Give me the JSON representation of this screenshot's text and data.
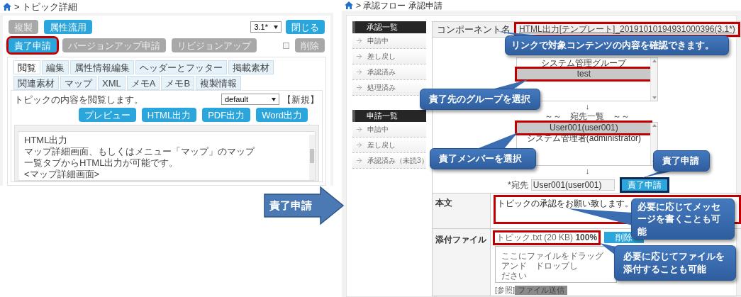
{
  "left_screen": {
    "breadcrumb": "> トピック詳細",
    "top_buttons": [
      {
        "label": "複製",
        "disabled": true
      },
      {
        "label": "属性流用",
        "disabled": false
      }
    ],
    "version_select": "3.1*",
    "close_button": "閉じる",
    "action_buttons": [
      {
        "label": "責了申請",
        "disabled": false,
        "highlighted": true
      },
      {
        "label": "バージョンアップ申請",
        "disabled": true,
        "highlighted": false
      },
      {
        "label": "リビジョンアップ",
        "disabled": true,
        "highlighted": false
      }
    ],
    "delete_checked": false,
    "delete_button": {
      "label": "削除",
      "disabled": true
    },
    "tabs": [
      {
        "label": "閲覧",
        "selected": true
      },
      {
        "label": "編集",
        "selected": false
      },
      {
        "label": "属性情報編集",
        "selected": false
      },
      {
        "label": "ヘッダーとフッター",
        "selected": false
      },
      {
        "label": "掲載素材",
        "selected": false
      },
      {
        "label": "関連素材",
        "selected": false
      },
      {
        "label": "マップ",
        "selected": false
      },
      {
        "label": "XML",
        "selected": false
      },
      {
        "label": "メモA",
        "selected": false
      },
      {
        "label": "メモB",
        "selected": false
      },
      {
        "label": "複製情報",
        "selected": false
      }
    ],
    "description": "トピックの内容を閲覧します。",
    "template_select": "default",
    "new_link": "【新規】",
    "output_buttons": [
      "プレビュー",
      "HTML出力",
      "PDF出力",
      "Word出力"
    ],
    "preview_lines": [
      "HTML出力",
      "マップ詳細画面、もしくはメニュー「マップ」のマップ一覧タブからHTML出力が可能です。",
      "<マップ詳細画面>"
    ]
  },
  "arrow_label": "責了申請",
  "right_screen": {
    "breadcrumb": "> 承認フロー 承認申請",
    "sidebar": [
      {
        "title": "承認一覧",
        "items": [
          "申請中",
          "差し戻し",
          "承認済み",
          "処理済み"
        ]
      },
      {
        "title": "申請一覧",
        "items": [
          "申請中",
          "差し戻し",
          "承認済み（未読3）"
        ]
      }
    ],
    "component": {
      "label": "コンポーネント名",
      "link": "HTML出力[テンプレート]_20191010194931000396(3.1*)",
      "highlighted": true
    },
    "groups": [
      {
        "label": "システム管理グループ",
        "selected": false,
        "highlighted": false
      },
      {
        "label": "test",
        "selected": true,
        "highlighted": true
      }
    ],
    "arrow_down_1": "↓",
    "recipients_heading": "～～　宛先一覧　～～",
    "members": [
      {
        "label": "User001(user001)",
        "selected": true,
        "highlighted": true
      },
      {
        "label": "システム管理者(administrator)",
        "selected": false,
        "highlighted": false
      }
    ],
    "arrow_down_2": "↓",
    "to_label": "*宛先",
    "to_value": "User001(user001)",
    "submit": {
      "label": "責了申請",
      "highlighted": true
    },
    "body": {
      "label": "本文",
      "value": "トピックの承認をお願い致します。",
      "highlighted": true
    },
    "attachment": {
      "label": "添付ファイル",
      "file": "トピック.txt (20 KB)",
      "progress": "100%",
      "highlighted": true,
      "delete_button": "削除",
      "drop_lines": [
        "ここにファイルをドラッグ",
        "アンド　ドロップし",
        "ださい"
      ],
      "browse_link": "[参照]",
      "send_button": "ファイル送信"
    }
  },
  "callouts": [
    "リンクで対象コンテンツの内容を確認できます。",
    "責了先のグループを選択",
    "責了メンバーを選択",
    "責了申請",
    "必要に応じてメッセージを書くことも可能",
    "必要に応じてファイルを添付することも可能"
  ]
}
